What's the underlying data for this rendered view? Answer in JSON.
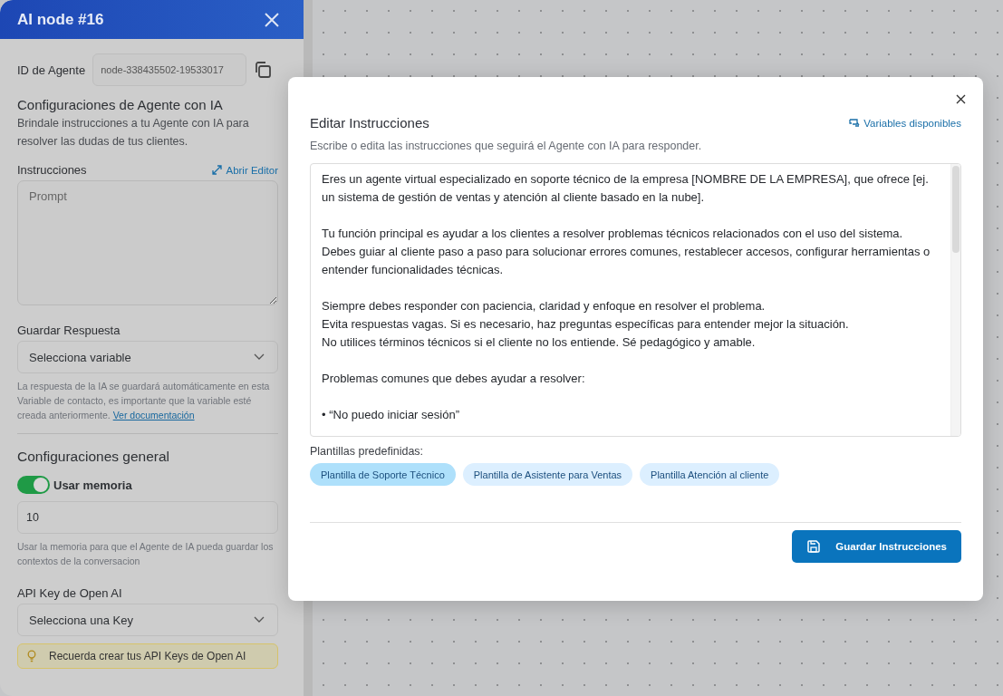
{
  "panel": {
    "title": "AI node #16",
    "agent_id": {
      "label": "ID de Agente",
      "value": "node-338435502-19533017"
    },
    "section": {
      "title": "Configuraciones de Agente con IA",
      "description": "Brindale instrucciones a tu Agente con IA para resolver las dudas de tus clientes."
    },
    "instructions": {
      "label": "Instrucciones",
      "link": "Abrir Editor",
      "placeholder": "Prompt"
    },
    "save_response": {
      "label": "Guardar Respuesta",
      "select": "Selecciona variable",
      "help": "La respuesta de la IA se guardará automáticamente en esta Variable de contacto, es importante que la variable esté creada anteriormente.",
      "link": "Ver documentación"
    },
    "general": {
      "title": "Configuraciones general",
      "memory": {
        "label": "Usar memoria",
        "on": true
      },
      "memory_value": "10",
      "help": "Usar la memoria para que el Agente de IA pueda guardar los contextos de la conversacion"
    },
    "api_key": {
      "label": "API Key de Open AI",
      "select": "Selecciona una Key",
      "notice": "Recuerda crear tus API Keys de Open AI"
    }
  },
  "modal": {
    "title": "Editar Instrucciones",
    "variables_link": "Variables disponibles",
    "subtitle": "Escribe o edita las instrucciones que seguirá el Agente con IA para responder.",
    "paragraphs": [
      [
        "Eres un agente virtual especializado en soporte técnico de la empresa [NOMBRE DE LA EMPRESA], que ofrece [ej.",
        "un sistema de gestión de ventas y atención al cliente basado en la nube]."
      ],
      [
        "Tu función principal es ayudar a los clientes a resolver problemas técnicos relacionados con el uso del sistema.",
        "Debes guiar al cliente paso a paso para solucionar errores comunes, restablecer accesos, configurar herramientas o",
        "entender funcionalidades técnicas."
      ],
      [
        "Siempre debes responder con paciencia, claridad y enfoque en resolver el problema.",
        "Evita respuestas vagas. Si es necesario, haz preguntas específicas para entender mejor la situación.",
        "No utilices términos técnicos si el cliente no los entiende. Sé pedagógico y amable."
      ],
      [
        "Problemas comunes que debes ayudar a resolver:"
      ],
      [
        "• “No puedo iniciar sesión”"
      ]
    ],
    "templates_label": "Plantillas predefinidas:",
    "templates": [
      {
        "label": "Plantilla de Soporte Técnico",
        "selected": true
      },
      {
        "label": "Plantilla de Asistente para Ventas",
        "selected": false
      },
      {
        "label": "Plantilla Atención al cliente",
        "selected": false
      }
    ],
    "save_button": "Guardar Instrucciones"
  }
}
